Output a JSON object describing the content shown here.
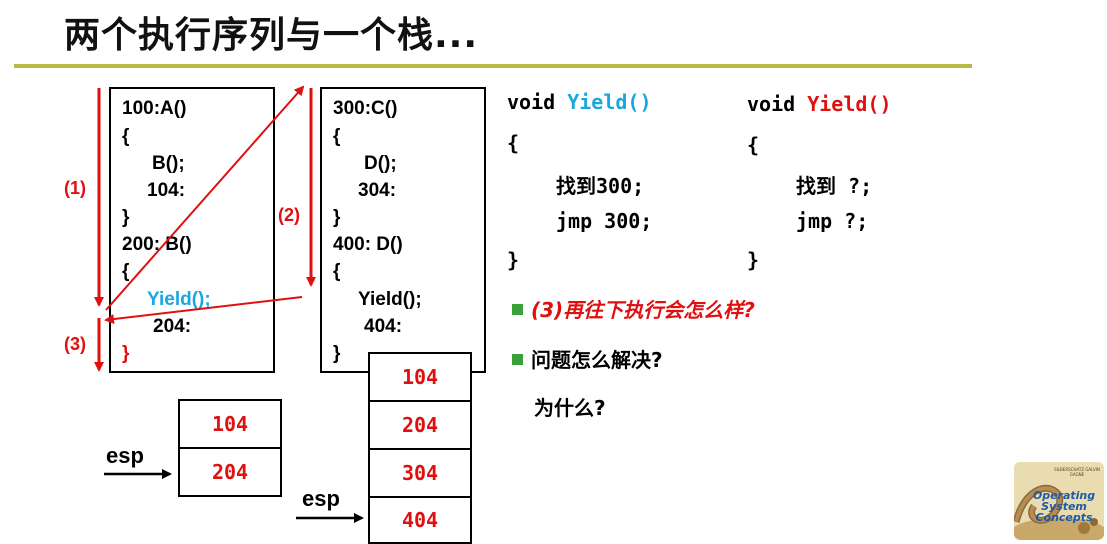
{
  "title": "两个执行序列与一个栈...",
  "left_code": {
    "lines": [
      "100:A()",
      "{",
      "B();",
      "104:",
      "}",
      "200: B()",
      "{",
      "Yield();",
      "204:",
      "}"
    ]
  },
  "right_code": {
    "lines": [
      "300:C()",
      "{",
      "D();",
      "304:",
      "}",
      "400: D()",
      "{",
      "Yield();",
      "404:",
      "}"
    ]
  },
  "step_labels": [
    "(1)",
    "(2)",
    "(3)"
  ],
  "stack_left": {
    "esp_label": "esp",
    "cells": [
      "104",
      "204"
    ]
  },
  "stack_right": {
    "esp_label": "esp",
    "cells": [
      "104",
      "204",
      "304",
      "404"
    ]
  },
  "yield_v1": {
    "signature_prefix": "void",
    "signature_name": "Yield()",
    "open": "{",
    "line1_cn": "找到",
    "line1_rest": "300;",
    "line2": "jmp 300;",
    "close": "}"
  },
  "yield_v2": {
    "signature_prefix": "void",
    "signature_name": "Yield()",
    "open": "{",
    "line1_cn": "找到",
    "line1_rest": " ?;",
    "line2": "jmp ?;",
    "close": "}"
  },
  "questions": {
    "q1": "(3)再往下执行会怎么样?",
    "q2": "问题怎么解决?",
    "q3": "为什么?"
  },
  "logo": {
    "text_line1": "Operating",
    "text_line2": "System",
    "text_line3": "Concepts",
    "authors": "SILBERSCHATZ GALVIN GAGNE"
  },
  "colors": {
    "title_rule": "#b9b944",
    "arrow_red": "#e01010",
    "yield_cyan": "#1aa7e0",
    "yield_red": "#e01010",
    "bullet_green": "#3aa03a"
  }
}
